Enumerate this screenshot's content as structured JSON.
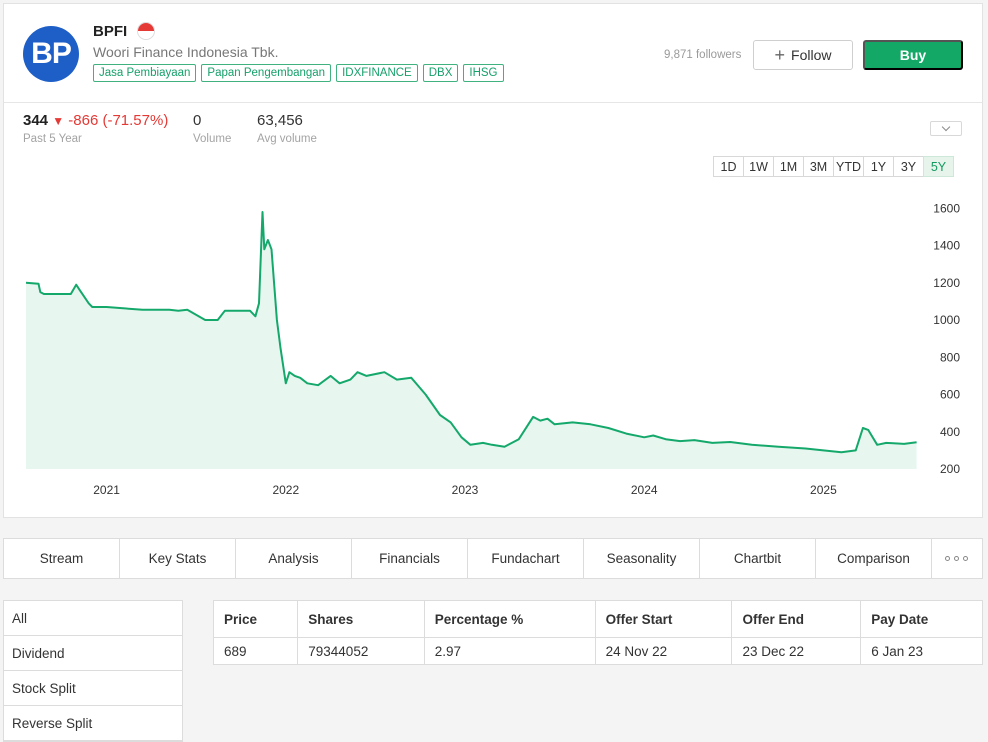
{
  "header": {
    "logo_text": "BP",
    "ticker": "BPFI",
    "company": "Woori Finance Indonesia Tbk.",
    "tags": [
      "Jasa Pembiayaan",
      "Papan Pengembangan",
      "IDXFINANCE",
      "DBX",
      "IHSG"
    ],
    "followers": "9,871 followers",
    "follow_label": "Follow",
    "buy_label": "Buy",
    "accent_color": "#13a866"
  },
  "stats": {
    "price": "344",
    "change": "-866 (-71.57%)",
    "period": "Past 5 Year",
    "volume": "0",
    "volume_label": "Volume",
    "avg_volume": "63,456",
    "avg_volume_label": "Avg volume"
  },
  "ranges": [
    "1D",
    "1W",
    "1M",
    "3M",
    "YTD",
    "1Y",
    "3Y",
    "5Y"
  ],
  "active_range": "5Y",
  "chart_data": {
    "type": "area",
    "title": "",
    "xlabel": "",
    "ylabel": "",
    "x_ticks": [
      "2021",
      "2022",
      "2023",
      "2024",
      "2025"
    ],
    "y_ticks": [
      200,
      400,
      600,
      800,
      1000,
      1200,
      1400,
      1600
    ],
    "ylim": [
      200,
      1650
    ],
    "xlim": [
      2020.55,
      2025.55
    ],
    "line_color": "#14a86b",
    "fill_color": "#e7f6ef",
    "series": [
      {
        "x": [
          2020.55,
          2020.62,
          2020.63,
          2020.65,
          2020.8,
          2020.83,
          2020.85,
          2020.9,
          2020.92,
          2021.0,
          2021.2,
          2021.35,
          2021.4,
          2021.45,
          2021.55,
          2021.62,
          2021.66,
          2021.8,
          2021.83,
          2021.85,
          2021.87,
          2021.88,
          2021.9,
          2021.92,
          2021.95,
          2021.97,
          2022.0,
          2022.02,
          2022.05,
          2022.08,
          2022.12,
          2022.18,
          2022.25,
          2022.3,
          2022.36,
          2022.4,
          2022.45,
          2022.55,
          2022.62,
          2022.7,
          2022.78,
          2022.86,
          2022.92,
          2022.98,
          2023.03,
          2023.1,
          2023.15,
          2023.22,
          2023.3,
          2023.38,
          2023.42,
          2023.46,
          2023.5,
          2023.6,
          2023.7,
          2023.8,
          2023.9,
          2024.0,
          2024.05,
          2024.12,
          2024.2,
          2024.28,
          2024.38,
          2024.48,
          2024.6,
          2024.75,
          2024.9,
          2025.0,
          2025.1,
          2025.18,
          2025.22,
          2025.25,
          2025.3,
          2025.35,
          2025.45,
          2025.52
        ],
        "y": [
          1200,
          1195,
          1150,
          1140,
          1140,
          1190,
          1160,
          1090,
          1070,
          1070,
          1055,
          1055,
          1050,
          1055,
          1000,
          1000,
          1050,
          1050,
          1020,
          1090,
          1580,
          1380,
          1430,
          1380,
          1000,
          850,
          660,
          720,
          700,
          690,
          660,
          650,
          700,
          660,
          680,
          720,
          700,
          720,
          680,
          690,
          600,
          490,
          450,
          370,
          330,
          340,
          330,
          320,
          360,
          480,
          460,
          470,
          440,
          450,
          440,
          420,
          390,
          370,
          380,
          360,
          350,
          355,
          340,
          345,
          330,
          320,
          310,
          300,
          290,
          300,
          420,
          410,
          330,
          340,
          335,
          344
        ]
      }
    ]
  },
  "tabs": [
    "Stream",
    "Key Stats",
    "Analysis",
    "Financials",
    "Fundachart",
    "Seasonality",
    "Chartbit",
    "Comparison"
  ],
  "side_items": [
    "All",
    "Dividend",
    "Stock Split",
    "Reverse Split"
  ],
  "table": {
    "headers": [
      "Price",
      "Shares",
      "Percentage %",
      "Offer Start",
      "Offer End",
      "Pay Date"
    ],
    "rows": [
      [
        "689",
        "79344052",
        "2.97",
        "24 Nov 22",
        "23 Dec 22",
        "6 Jan 23"
      ]
    ]
  }
}
